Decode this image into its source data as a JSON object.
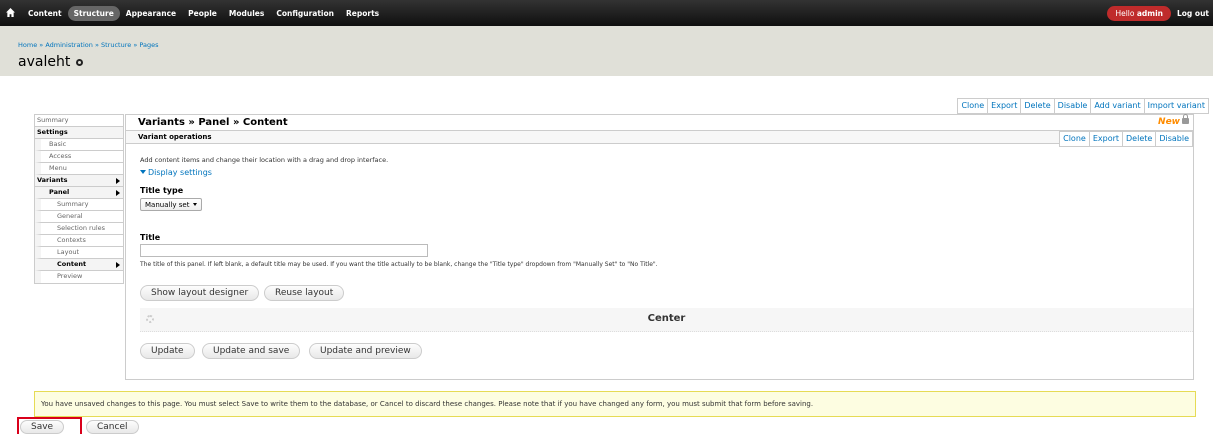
{
  "toolbar": {
    "menu": [
      "Content",
      "Structure",
      "Appearance",
      "People",
      "Modules",
      "Configuration",
      "Reports"
    ],
    "hello_prefix": "Hello ",
    "user": "admin",
    "logout": "Log out",
    "accent": "#bf2b2b"
  },
  "breadcrumb": {
    "items": [
      "Home",
      "Administration",
      "Structure",
      "Pages"
    ],
    "sep": " » "
  },
  "page": {
    "title": "avaleht"
  },
  "top_ops": [
    "Clone",
    "Export",
    "Delete",
    "Disable",
    "Add variant",
    "Import variant"
  ],
  "sidebar": {
    "items": [
      {
        "label": "Summary"
      },
      {
        "label": "Settings"
      },
      {
        "label": "Basic"
      },
      {
        "label": "Access"
      },
      {
        "label": "Menu"
      },
      {
        "label": "Variants"
      },
      {
        "label": "Panel"
      },
      {
        "label": "Summary"
      },
      {
        "label": "General"
      },
      {
        "label": "Selection rules"
      },
      {
        "label": "Contexts"
      },
      {
        "label": "Layout"
      },
      {
        "label": "Content"
      },
      {
        "label": "Preview"
      }
    ]
  },
  "main": {
    "title": "Variants » Panel » Content",
    "new_badge": "New",
    "ops_label": "Variant operations",
    "ops": [
      "Clone",
      "Export",
      "Delete",
      "Disable"
    ],
    "description": "Add content items and change their location with a drag and drop interface.",
    "display_settings": "Display settings",
    "title_type_label": "Title type",
    "title_type_value": "Manually set",
    "title_label": "Title",
    "title_value": "",
    "title_help": "The title of this panel. If left blank, a default title may be used. If you want the title actually to be blank, change the \"Title type\" dropdown from \"Manually Set\" to \"No Title\".",
    "show_layout_designer": "Show layout designer",
    "reuse_layout": "Reuse layout",
    "region_label": "Center",
    "update": "Update",
    "update_and_save": "Update and save",
    "update_and_preview": "Update and preview"
  },
  "warning": "You have unsaved changes to this page. You must select Save to write them to the database, or Cancel to discard these changes. Please note that if you have changed any form, you must submit that form before saving.",
  "footer": {
    "save": "Save",
    "cancel": "Cancel"
  }
}
